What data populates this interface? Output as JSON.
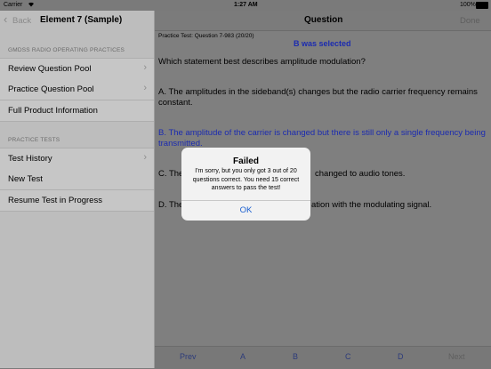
{
  "status": {
    "carrier": "Carrier",
    "time": "1:27 AM",
    "battery": "100%"
  },
  "sidebar": {
    "back_label": "Back",
    "title": "Element 7 (Sample)",
    "section1_header": "GMDSS RADIO OPERATING PRACTICES",
    "section1_items": [
      {
        "label": "Review Question Pool"
      },
      {
        "label": "Practice Question Pool"
      },
      {
        "label": "Full Product Information"
      }
    ],
    "section2_header": "PRACTICE TESTS",
    "section2_items": [
      {
        "label": "Test History"
      },
      {
        "label": "New Test"
      },
      {
        "label": "Resume Test in Progress"
      }
    ]
  },
  "main": {
    "title": "Question",
    "done_label": "Done",
    "test_info": "Practice Test:  Question 7-983 (20/20)",
    "selection_status": "B was selected",
    "question": "Which statement best describes amplitude modulation?",
    "answers": [
      {
        "text": "A. The amplitudes in the sideband(s) changes but the radio carrier frequency remains constant."
      },
      {
        "text": "B. The amplitude of the carrier is changed but there is still only a single frequency being transmitted."
      },
      {
        "text": "C. The",
        "tail": "changed to audio tones."
      },
      {
        "text": "D. The",
        "tail": "ation with the modulating signal."
      }
    ],
    "toolbar": {
      "prev": "Prev",
      "a": "A",
      "b": "B",
      "c": "C",
      "d": "D",
      "next": "Next"
    }
  },
  "dialog": {
    "title": "Failed",
    "message": "I'm sorry, but you only got 3 out of 20 questions correct.  You need 15 correct answers to pass the test!",
    "ok_label": "OK"
  },
  "colors": {
    "accent": "#1a5fd0",
    "selected_answer": "#1b2bb0"
  }
}
